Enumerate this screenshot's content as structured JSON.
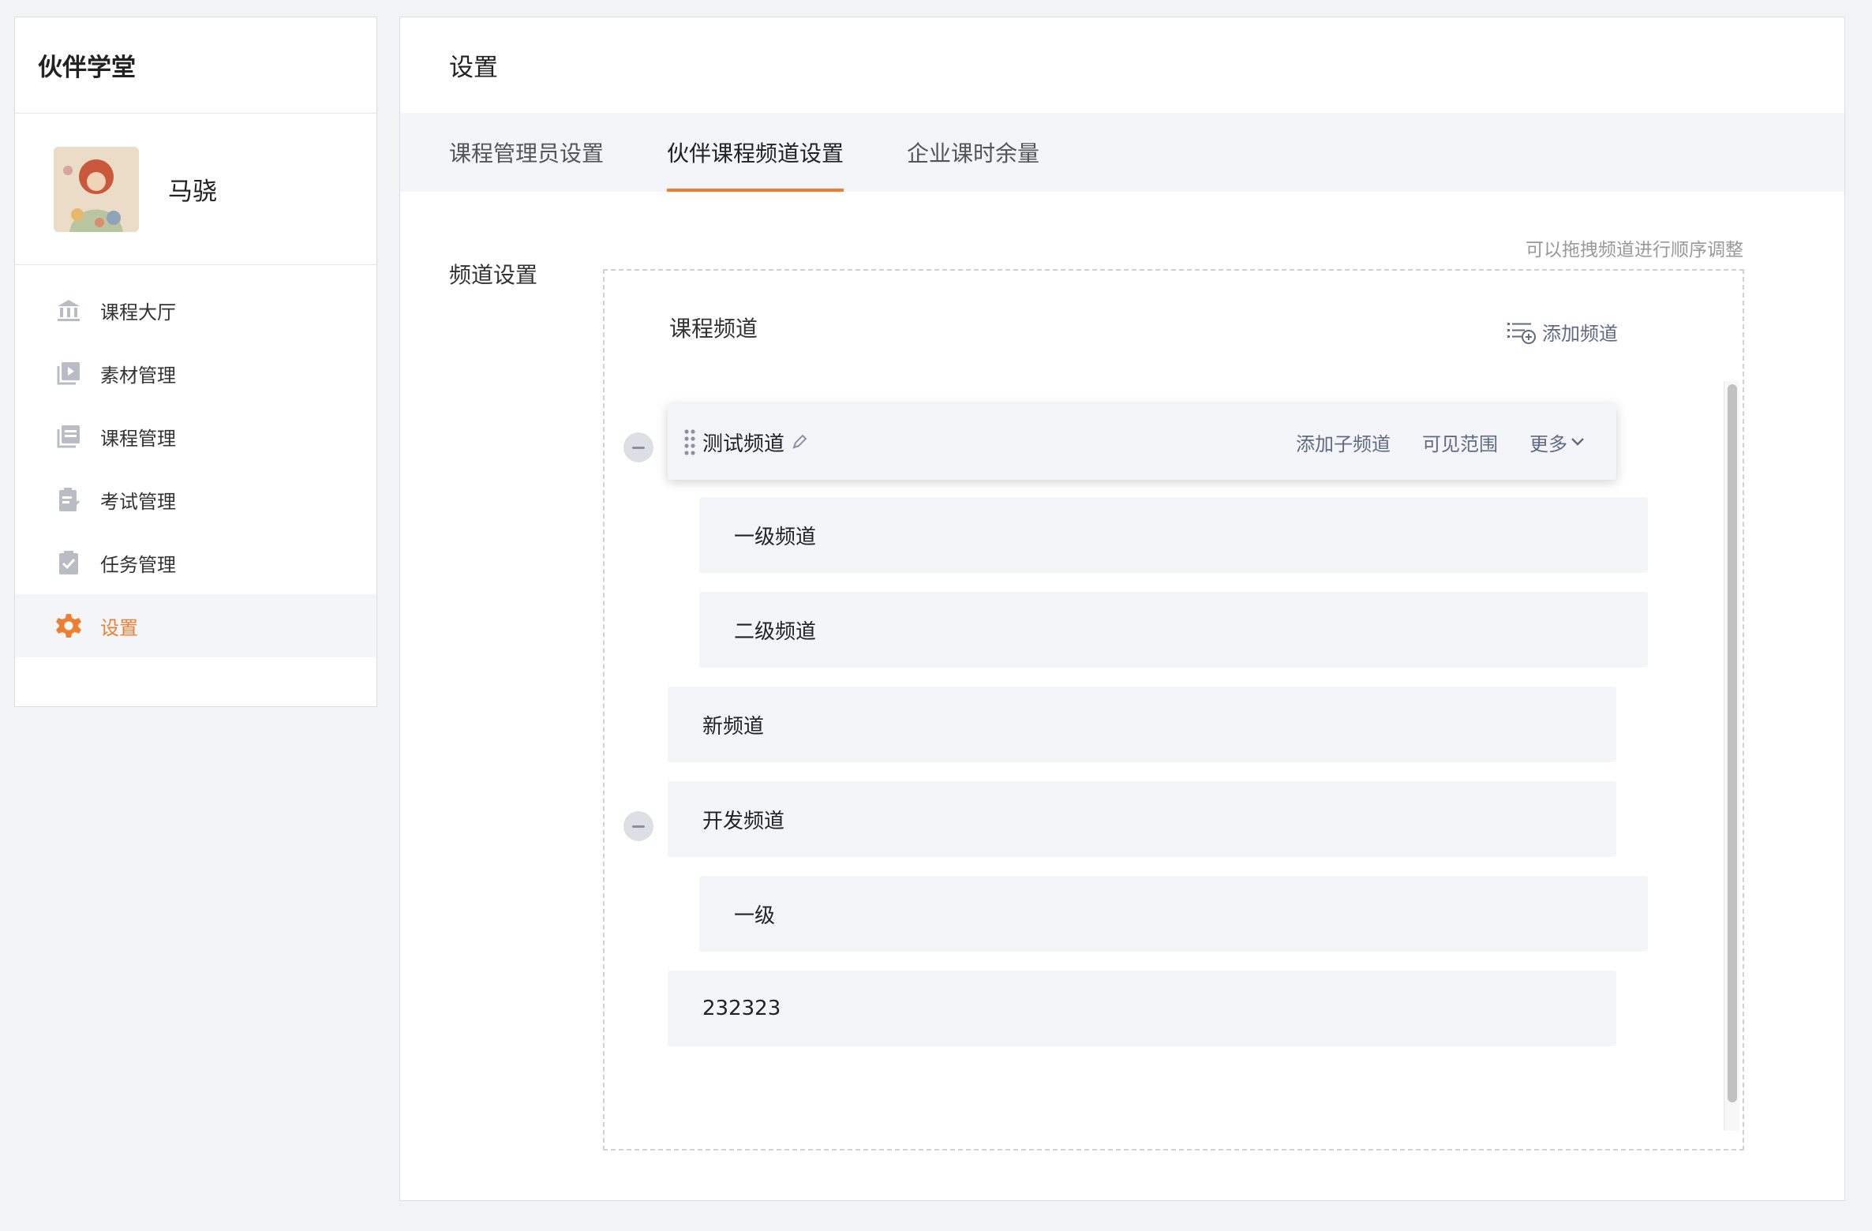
{
  "app": {
    "brand": "伙伴学堂"
  },
  "user": {
    "name": "马骁"
  },
  "nav": [
    {
      "label": "课程大厅",
      "icon": "building-icon"
    },
    {
      "label": "素材管理",
      "icon": "media-icon"
    },
    {
      "label": "课程管理",
      "icon": "course-icon"
    },
    {
      "label": "考试管理",
      "icon": "exam-icon"
    },
    {
      "label": "任务管理",
      "icon": "task-icon"
    },
    {
      "label": "设置",
      "icon": "gear-icon",
      "active": true
    }
  ],
  "page": {
    "title": "设置"
  },
  "tabs": [
    {
      "label": "课程管理员设置"
    },
    {
      "label": "伙伴课程频道设置",
      "active": true
    },
    {
      "label": "企业课时余量"
    }
  ],
  "channel_settings": {
    "section_label": "频道设置",
    "drag_hint": "可以拖拽频道进行顺序调整",
    "box_title": "课程频道",
    "add_channel": "添加频道",
    "rows": [
      {
        "label": "测试频道",
        "level": 0,
        "expanded": true
      },
      {
        "label": "一级频道",
        "level": 1
      },
      {
        "label": "二级频道",
        "level": 1
      },
      {
        "label": "新频道",
        "level": 0
      },
      {
        "label": "开发频道",
        "level": 0,
        "expanded": true
      },
      {
        "label": "一级",
        "level": 1
      },
      {
        "label": "232323",
        "level": 0
      }
    ],
    "row_actions": {
      "add_sub": "添加子频道",
      "visibility": "可见范围",
      "more": "更多"
    }
  },
  "colors": {
    "accent": "#ef7f30",
    "action_text": "#5e6b82",
    "row_bg": "#f4f5f9",
    "page_bg": "#f2f3f5"
  }
}
